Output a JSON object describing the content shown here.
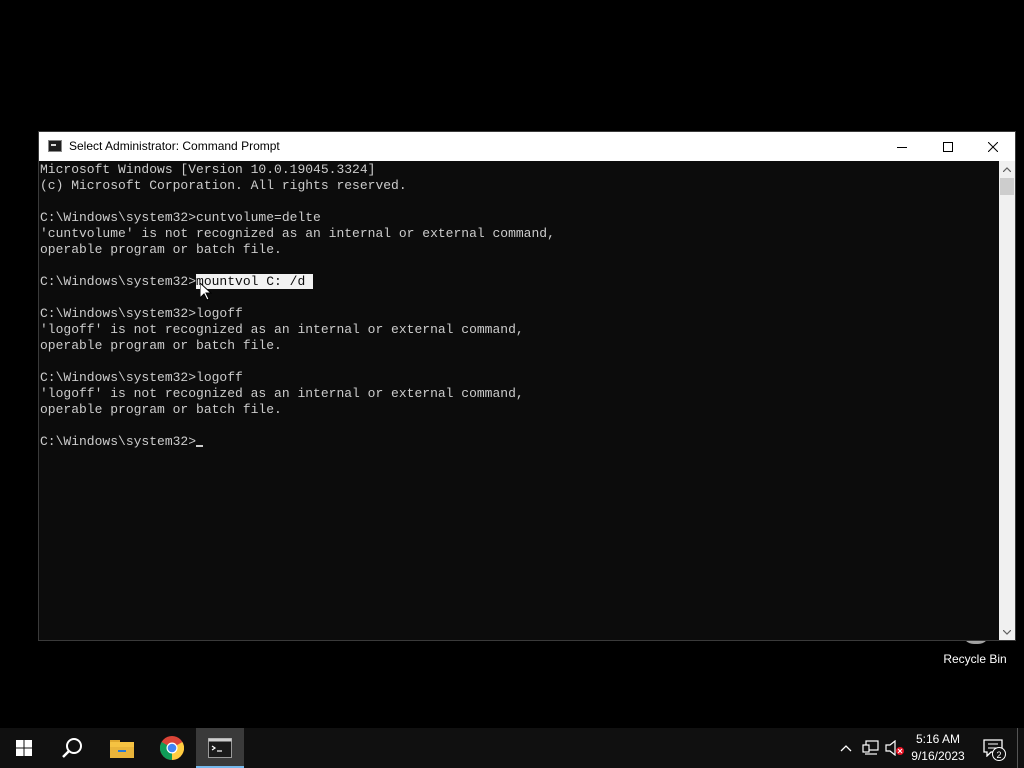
{
  "desktop": {
    "recycle_bin_label": "Recycle Bin"
  },
  "window": {
    "title": "Select Administrator: Command Prompt",
    "icon": "console-icon",
    "controls": [
      "minimize-icon",
      "maximize-icon",
      "close-icon"
    ]
  },
  "console": {
    "lines": [
      "Microsoft Windows [Version 10.0.19045.3324]",
      "(c) Microsoft Corporation. All rights reserved.",
      "",
      "C:\\Windows\\system32>cuntvolume=delte",
      "'cuntvolume' is not recognized as an internal or external command,",
      "operable program or batch file.",
      "",
      "",
      "",
      "C:\\Windows\\system32>logoff",
      "'logoff' is not recognized as an internal or external command,",
      "operable program or batch file.",
      "",
      "C:\\Windows\\system32>logoff",
      "'logoff' is not recognized as an internal or external command,",
      "operable program or batch file.",
      "",
      ""
    ],
    "selection_line": {
      "prompt": "C:\\Windows\\system32>",
      "selected_text": "mountvol C: /d "
    },
    "current_prompt": "C:\\Windows\\system32>",
    "text_color": "#cccccc",
    "background_color": "#0c0c0c",
    "selection_color": "#f2f2f2"
  },
  "taskbar": {
    "start_icon": "windows-start-icon",
    "search_icon": "search-icon",
    "pinned": [
      "file-explorer-icon",
      "chrome-icon",
      "command-prompt-icon"
    ],
    "active_app": "command-prompt-icon",
    "accent_color": "#76b9ed",
    "tray": {
      "time": "5:16 AM",
      "date": "9/16/2023",
      "notification_count": "2"
    }
  }
}
